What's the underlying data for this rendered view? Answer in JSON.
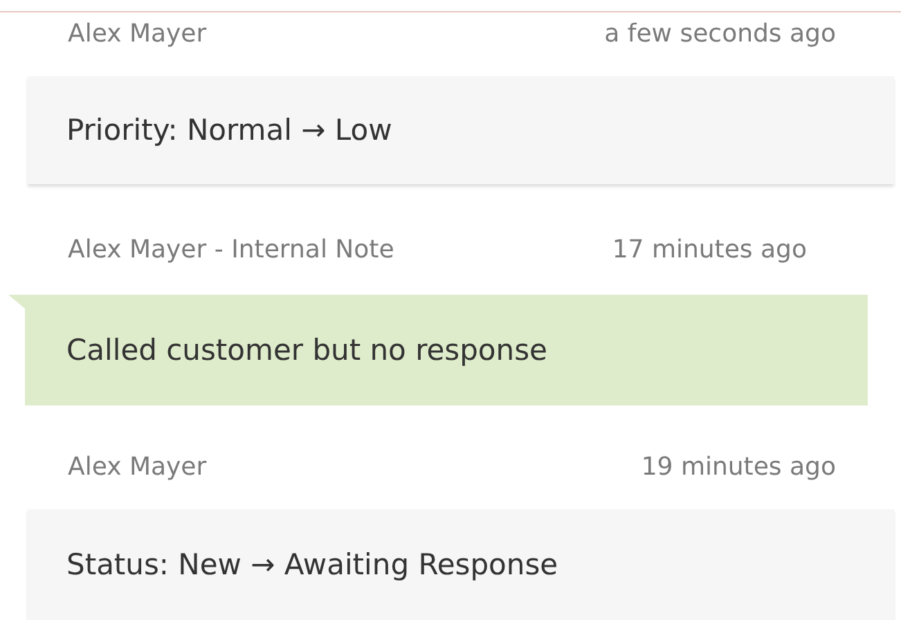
{
  "entries": [
    {
      "kind": "change",
      "author": "Alex Mayer",
      "time": "a few seconds ago",
      "text": "Priority: Normal → Low"
    },
    {
      "kind": "note",
      "author": "Alex Mayer - Internal Note",
      "time": "17 minutes ago",
      "text": "Called customer but no response"
    },
    {
      "kind": "change",
      "author": "Alex Mayer",
      "time": "19 minutes ago",
      "text": "Status: New → Awaiting Response"
    }
  ]
}
